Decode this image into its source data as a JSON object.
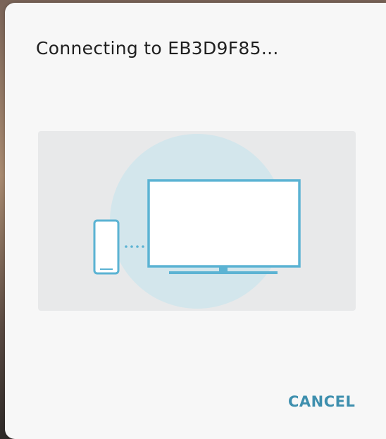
{
  "dialog": {
    "title": "Connecting to EB3D9F85...",
    "cancel_label": "CANCEL"
  },
  "illustration": {
    "icons": [
      "phone-icon",
      "tv-icon",
      "connection-dots-icon"
    ],
    "colors": {
      "panel": "#e8e9ea",
      "circle": "#d3e6ec",
      "device_stroke": "#5bb3d3",
      "device_fill": "#ffffff"
    }
  },
  "colors": {
    "dialog_background": "#f7f7f7",
    "accent": "#3e8fae",
    "title_text": "#202020"
  }
}
